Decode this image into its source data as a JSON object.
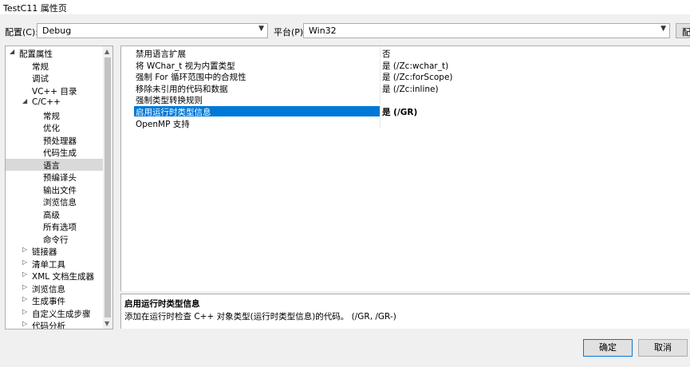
{
  "window": {
    "title": "TestC11 属性页"
  },
  "toolbar": {
    "config_label": "配置(C):",
    "config_value": "Debug",
    "platform_label": "平台(P):",
    "platform_value": "Win32",
    "config_manager_label": "配"
  },
  "tree": {
    "items": [
      {
        "label": "配置属性",
        "twisty": "expanded"
      },
      {
        "label": "常规"
      },
      {
        "label": "调试"
      },
      {
        "label": "VC++ 目录"
      },
      {
        "label": "C/C++",
        "twisty": "expanded"
      },
      {
        "label": "常规"
      },
      {
        "label": "优化"
      },
      {
        "label": "预处理器"
      },
      {
        "label": "代码生成"
      },
      {
        "label": "语言",
        "selected": true
      },
      {
        "label": "预编译头"
      },
      {
        "label": "输出文件"
      },
      {
        "label": "浏览信息"
      },
      {
        "label": "高级"
      },
      {
        "label": "所有选项"
      },
      {
        "label": "命令行"
      },
      {
        "label": "链接器",
        "twisty": "collapsed"
      },
      {
        "label": "清单工具",
        "twisty": "collapsed"
      },
      {
        "label": "XML 文档生成器",
        "twisty": "collapsed"
      },
      {
        "label": "浏览信息",
        "twisty": "collapsed"
      },
      {
        "label": "生成事件",
        "twisty": "collapsed"
      },
      {
        "label": "自定义生成步骤",
        "twisty": "collapsed"
      },
      {
        "label": "代码分析",
        "twisty": "collapsed"
      }
    ]
  },
  "properties": [
    {
      "name": "禁用语言扩展",
      "value": "否"
    },
    {
      "name": "将 WChar_t 视为内置类型",
      "value": "是 (/Zc:wchar_t)"
    },
    {
      "name": "强制 For 循环范围中的合规性",
      "value": "是 (/Zc:forScope)"
    },
    {
      "name": "移除未引用的代码和数据",
      "value": "是 (/Zc:inline)"
    },
    {
      "name": "强制类型转换规则",
      "value": ""
    },
    {
      "name": "启用运行时类型信息",
      "value": "是 (/GR)",
      "selected": true
    },
    {
      "name": "OpenMP 支持",
      "value": ""
    }
  ],
  "description": {
    "title": "启用运行时类型信息",
    "text": "添加在运行时检查 C++ 对象类型(运行时类型信息)的代码。      (/GR, /GR-)"
  },
  "buttons": {
    "ok": "确定",
    "cancel": "取消"
  },
  "colors": {
    "selection": "#0078d7",
    "tree_selection": "#d9d9d9"
  }
}
